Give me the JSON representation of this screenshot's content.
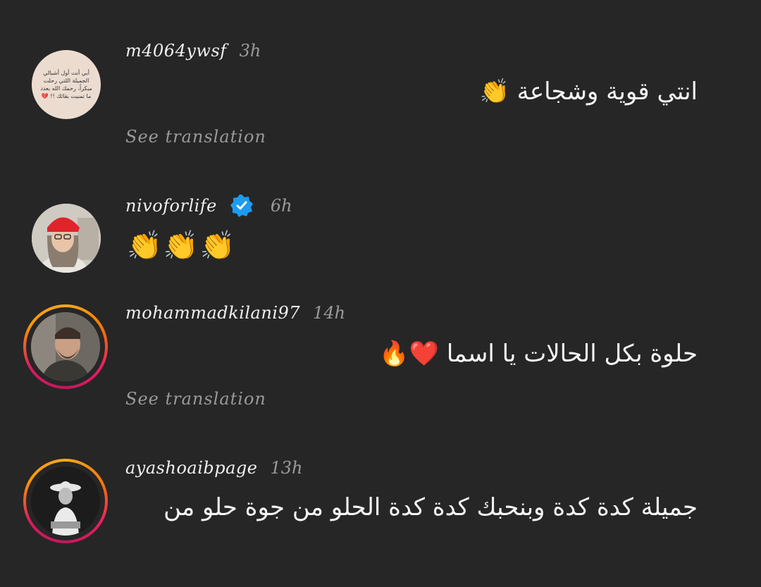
{
  "comments": [
    {
      "username": "m4064ywsf",
      "time": "3h",
      "text": "انتي قوية وشجاعة 👏",
      "see_translation": "See translation",
      "avatar_text": "أبي أنت أول أشبالي الجميلة اللتي رحلت مبكراً، رحمك الله بعدد ما تمنيت بقائك !! 💔"
    },
    {
      "username": "nivoforlife",
      "time": "6h",
      "text": "👏👏👏",
      "verified": true
    },
    {
      "username": "mohammadkilani97",
      "time": "14h",
      "text": "حلوة بكل الحالات يا اسما ❤️🔥",
      "see_translation": "See translation"
    },
    {
      "username": "ayashoaibpage",
      "time": "13h",
      "text_line1": "جميلة كدة كدة وبنحبك كدة كدة الحلو من جوة حلو من"
    }
  ],
  "colors": {
    "background": "#262626",
    "verified": "#1d9bf0",
    "muted": "#9a9a9a"
  }
}
